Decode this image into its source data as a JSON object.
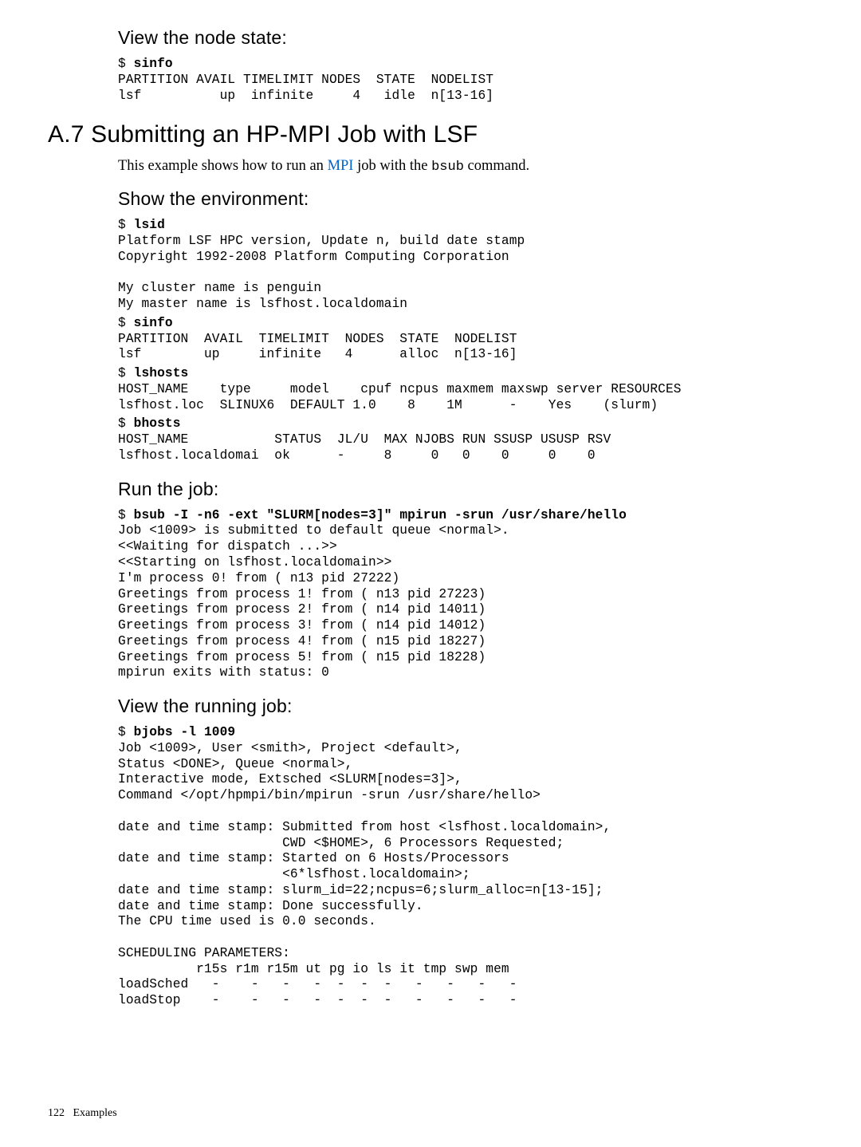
{
  "sec1": {
    "title": "View the node state:",
    "block": "$ <b>sinfo</b>\nPARTITION AVAIL TIMELIMIT NODES  STATE  NODELIST\nlsf          up  infinite     4   idle  n[13-16]"
  },
  "h2": "A.7 Submitting an HP-MPI Job with LSF",
  "intro_pre": "This example shows how to run an ",
  "intro_link": "MPI",
  "intro_mid": " job with the ",
  "intro_code": "bsub",
  "intro_post": " command.",
  "sec2": {
    "title": "Show the environment:",
    "b1": "$ <b>lsid</b>\nPlatform LSF HPC version, Update n, build date stamp\nCopyright 1992-2008 Platform Computing Corporation\n\nMy cluster name is penguin\nMy master name is lsfhost.localdomain",
    "b2": "$ <b>sinfo</b>\nPARTITION  AVAIL  TIMELIMIT  NODES  STATE  NODELIST\nlsf        up     infinite   4      alloc  n[13-16]",
    "b3": "$ <b>lshosts</b>\nHOST_NAME    type     model    cpuf ncpus maxmem maxswp server RESOURCES\nlsfhost.loc  SLINUX6  DEFAULT 1.0    8    1M      -    Yes    (slurm)",
    "b4": "$ <b>bhosts</b>\nHOST_NAME           STATUS  JL/U  MAX NJOBS RUN SSUSP USUSP RSV\nlsfhost.localdomai  ok      -     8     0   0    0     0    0"
  },
  "sec3": {
    "title": "Run the job:",
    "block": "$ <b>bsub -I -n6 -ext \"SLURM[nodes=3]\" mpirun -srun /usr/share/hello</b>\nJob <1009> is submitted to default queue <normal>.\n<<Waiting for dispatch ...>>\n<<Starting on lsfhost.localdomain>>\nI'm process 0! from ( n13 pid 27222)\nGreetings from process 1! from ( n13 pid 27223)\nGreetings from process 2! from ( n14 pid 14011)\nGreetings from process 3! from ( n14 pid 14012)\nGreetings from process 4! from ( n15 pid 18227)\nGreetings from process 5! from ( n15 pid 18228)\nmpirun exits with status: 0"
  },
  "sec4": {
    "title": "View the running job:",
    "block": "$ <b>bjobs -l 1009</b>\nJob <1009>, User <smith>, Project <default>,\nStatus <DONE>, Queue <normal>,\nInteractive mode, Extsched <SLURM[nodes=3]>,\nCommand </opt/hpmpi/bin/mpirun -srun /usr/share/hello>\n\ndate and time stamp: Submitted from host <lsfhost.localdomain>,\n                     CWD <$HOME>, 6 Processors Requested;\ndate and time stamp: Started on 6 Hosts/Processors\n                     <6*lsfhost.localdomain>;\ndate and time stamp: slurm_id=22;ncpus=6;slurm_alloc=n[13-15];\ndate and time stamp: Done successfully.\nThe CPU time used is 0.0 seconds.\n\nSCHEDULING PARAMETERS:\n          r15s r1m r15m ut pg io ls it tmp swp mem\nloadSched   -    -   -   -  -  -  -   -   -   -   -\nloadStop    -    -   -   -  -  -  -   -   -   -   -"
  },
  "footer": {
    "page": "122",
    "label": "Examples"
  }
}
